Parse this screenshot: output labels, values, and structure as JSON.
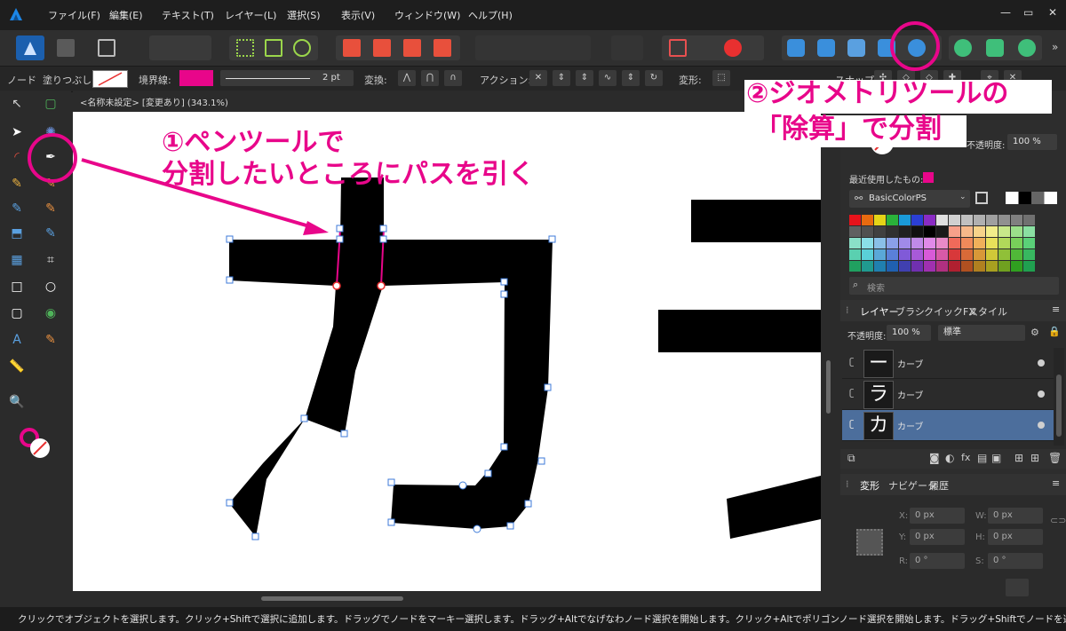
{
  "menu": {
    "items": [
      "ファイル(F)",
      "編集(E)",
      "テキスト(T)",
      "レイヤー(L)",
      "選択(S)",
      "表示(V)",
      "ウィンドウ(W)",
      "ヘルプ(H)"
    ],
    "window_controls": [
      "—",
      "▭",
      "✕"
    ]
  },
  "context": {
    "tool_label": "ノード",
    "fill_label": "塗りつぶし:",
    "stroke_label": "境界線:",
    "stroke_width": "2 pt",
    "convert_label": "変換:",
    "action_label": "アクション:",
    "transform_label": "変形:",
    "snap_label": "スナップ"
  },
  "document": {
    "tab_title": "<名称未設定> [変更あり] (343.1%)"
  },
  "annotations": {
    "step1_line1": "①ペンツールで",
    "step1_line2": "分割したいところにパスを引く",
    "step2_line1": "②ジオメトリツールの",
    "step2_line2": "「除算」で分割"
  },
  "color_panel": {
    "opacity_label": "不透明度:",
    "opacity_value": "100 %",
    "recent_label": "最近使用したもの:",
    "palette_name": "BasicColorPS",
    "search_placeholder": "検索"
  },
  "layers_panel": {
    "tabs": [
      "レイヤー",
      "ブラシ",
      "クイックFX",
      "スタイル"
    ],
    "opacity_label": "不透明度:",
    "opacity_value": "100 %",
    "blend_mode": "標準",
    "layers": [
      {
        "name": "カーブ",
        "thumb": "ー"
      },
      {
        "name": "カーブ",
        "thumb": "ラ"
      },
      {
        "name": "カーブ",
        "thumb": "カ"
      }
    ]
  },
  "transform_panel": {
    "tabs": [
      "変形",
      "ナビゲータ",
      "履歴"
    ],
    "x_label": "X:",
    "x_value": "0 px",
    "y_label": "Y:",
    "y_value": "0 px",
    "w_label": "W:",
    "w_value": "0 px",
    "h_label": "H:",
    "h_value": "0 px",
    "r_label": "R:",
    "r_value": "0 °",
    "s_label": "S:",
    "s_value": "0 °"
  },
  "status": {
    "text": "クリックでオブジェクトを選択します。クリック+Shiftで選択に追加します。ドラッグでノードをマーキー選択します。ドラッグ+Altでなげなわノード選択を開始します。クリック+Altでポリゴンノード選択を開始します。ドラッグ+Shiftでノードを選択に追加します。ドラッグ+マウスの右ボ"
  },
  "colors": {
    "accent": "#e8068a",
    "selected_layer": "#4c6e9c",
    "canvas": "#ffffff",
    "glyph": "#000000",
    "fill_swatch": "#ffffff",
    "stroke_swatch": "#e8068a"
  }
}
